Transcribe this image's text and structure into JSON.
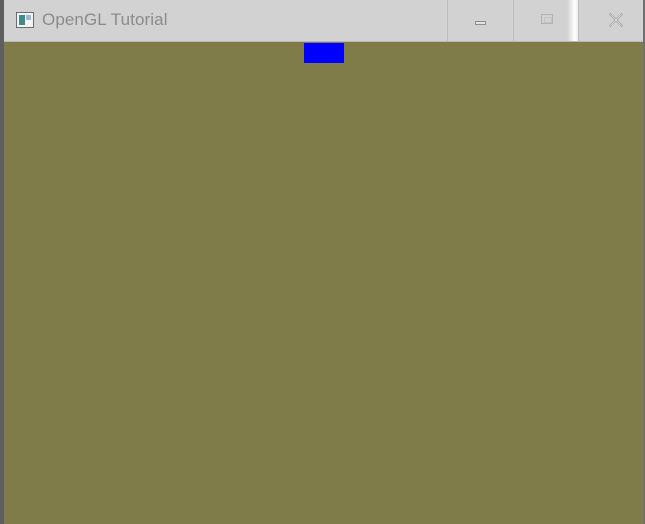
{
  "window": {
    "title": "OpenGL Tutorial",
    "clear_color": "#7f7c4a",
    "titlebar_color": "#d2d2d2"
  },
  "icons": {
    "app": "opengl-app-icon",
    "minimize": "minimize-icon",
    "maximize": "maximize-icon",
    "close": "close-icon"
  },
  "scene": {
    "shape": "rectangle",
    "color": "#0000ff"
  }
}
